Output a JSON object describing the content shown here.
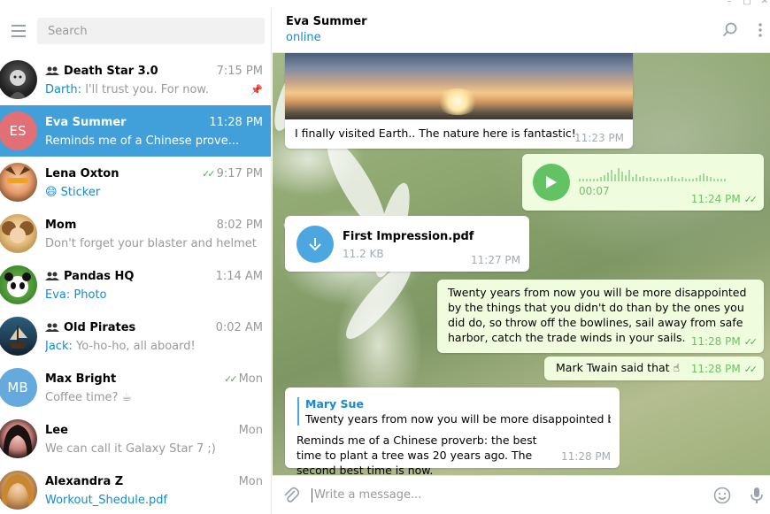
{
  "search": {
    "placeholder": "Search"
  },
  "chats": [
    {
      "name": "Death Star 3.0",
      "time": "7:15 PM",
      "sender": "Darth:",
      "preview": "I'll trust you. For now.",
      "group": true,
      "pinned": true
    },
    {
      "name": "Eva Summer",
      "time": "11:28 PM",
      "sender": "",
      "preview": "Reminds me of a Chinese prove...",
      "initials": "ES",
      "active": true
    },
    {
      "name": "Lena Oxton",
      "time": "9:17 PM",
      "sender": "",
      "preview": "😄 Sticker",
      "read": true
    },
    {
      "name": "Mom",
      "time": "8:02 PM",
      "sender": "",
      "preview": "Don't forget your blaster and helmet"
    },
    {
      "name": "Pandas HQ",
      "time": "1:14 AM",
      "sender": "Eva:",
      "preview": "Photo",
      "group": true
    },
    {
      "name": "Old Pirates",
      "time": "0:02 AM",
      "sender": "Jack:",
      "preview": "Yo-ho-ho, all aboard!",
      "group": true
    },
    {
      "name": "Max Bright",
      "time": "Mon",
      "sender": "",
      "preview": "Coffee time? ☕",
      "initials": "MB",
      "read": true
    },
    {
      "name": "Lee",
      "time": "Mon",
      "sender": "",
      "preview": "We can call it Galaxy Star 7 ;)"
    },
    {
      "name": "Alexandra Z",
      "time": "Mon",
      "sender": "",
      "preview": "Workout_Shedule.pdf"
    }
  ],
  "header": {
    "name": "Eva Summer",
    "status": "online"
  },
  "messages": {
    "photo_caption": "I finally visited Earth.. The nature here is fantastic!",
    "photo_time": "11:23 PM",
    "voice_duration": "00:07",
    "voice_time": "11:24 PM",
    "file_name": "First Impression.pdf",
    "file_size": "11.2 KB",
    "file_time": "11:27 PM",
    "quote_text": "Twenty years from now you will be more disappointed by the things that you didn't do than by the ones you did do, so throw off the bowlines, sail away from safe harbor, catch the trade winds in your sails.",
    "quote_time": "11:28 PM",
    "twain_text": "Mark Twain said that ☝",
    "twain_time": "11:28 PM",
    "reply_author": "Mary Sue",
    "reply_snippet": "Twenty years from now you will be more disappointed by t...",
    "reply_text": "Reminds me of a Chinese proverb: the best time to plant a tree was 20 years ago. The second best time is now.",
    "reply_time": "11:28 PM"
  },
  "composer": {
    "placeholder": "Write a message..."
  },
  "colors": {
    "accent": "#419fd9",
    "link": "#168acd",
    "outgoing": "#effdde",
    "read_ticks": "#4fae4e",
    "avatar_es": "#e17076",
    "avatar_mb": "#65aadd"
  }
}
